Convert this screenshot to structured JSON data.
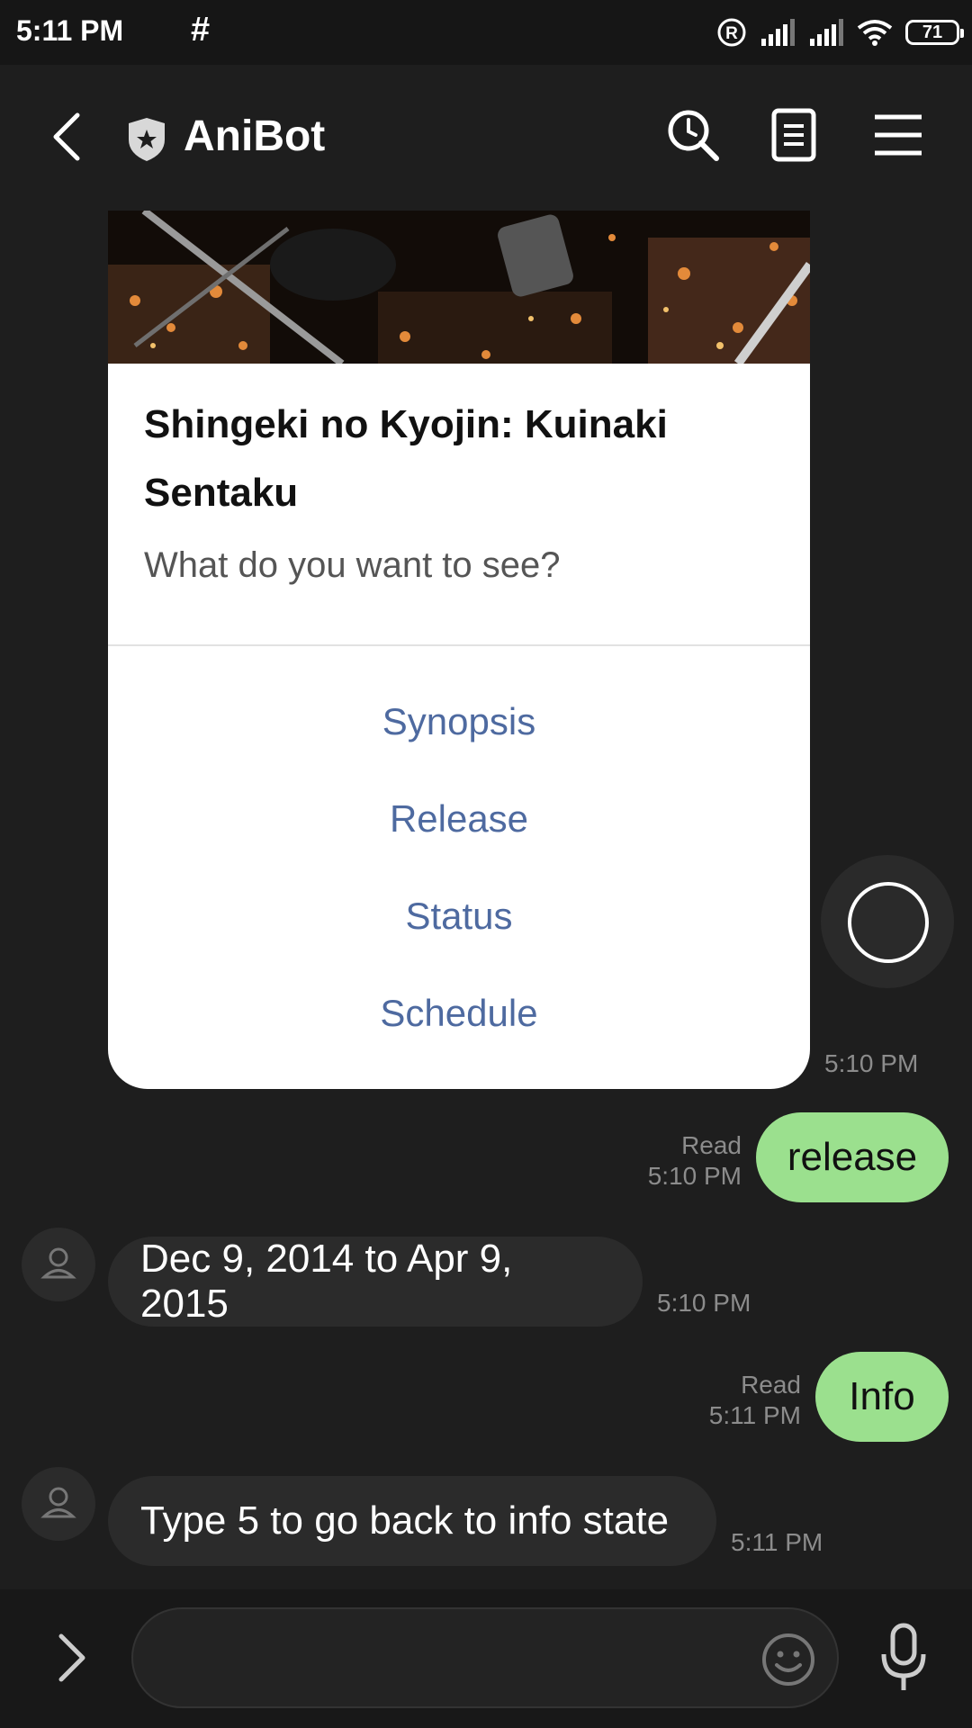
{
  "status_bar": {
    "time": "5:11 PM",
    "notification_symbol": "#",
    "battery_level": "71",
    "icons": [
      "registered-icon",
      "signal-icon",
      "signal-icon",
      "wifi-icon",
      "battery-icon"
    ]
  },
  "header": {
    "title": "AniBot",
    "icons": [
      "back-arrow-icon",
      "shield-icon",
      "search-history-icon",
      "notes-icon",
      "menu-icon"
    ]
  },
  "card": {
    "title": "Shingeki no Kyojin: Kuinaki Sentaku",
    "subtitle": "What do you want to see?",
    "options": [
      "Synopsis",
      "Release",
      "Status",
      "Schedule"
    ],
    "timestamp": "5:10 PM"
  },
  "messages": [
    {
      "direction": "out",
      "text": "release",
      "read": "Read",
      "time": "5:10 PM"
    },
    {
      "direction": "in",
      "text": "Dec 9, 2014 to Apr 9, 2015",
      "time": "5:10 PM"
    },
    {
      "direction": "out",
      "text": "Info",
      "read": "Read",
      "time": "5:11 PM"
    },
    {
      "direction": "in",
      "text": "Type 5 to go back to info state",
      "time": "5:11 PM"
    }
  ],
  "composer": {
    "placeholder": "",
    "icons": [
      "expand-chevron-icon",
      "emoji-icon",
      "microphone-icon"
    ]
  },
  "colors": {
    "background": "#1e1e1e",
    "outgoing_bubble": "#9be08e",
    "incoming_bubble": "#2b2b2b",
    "option_link": "#4e6aa0"
  }
}
